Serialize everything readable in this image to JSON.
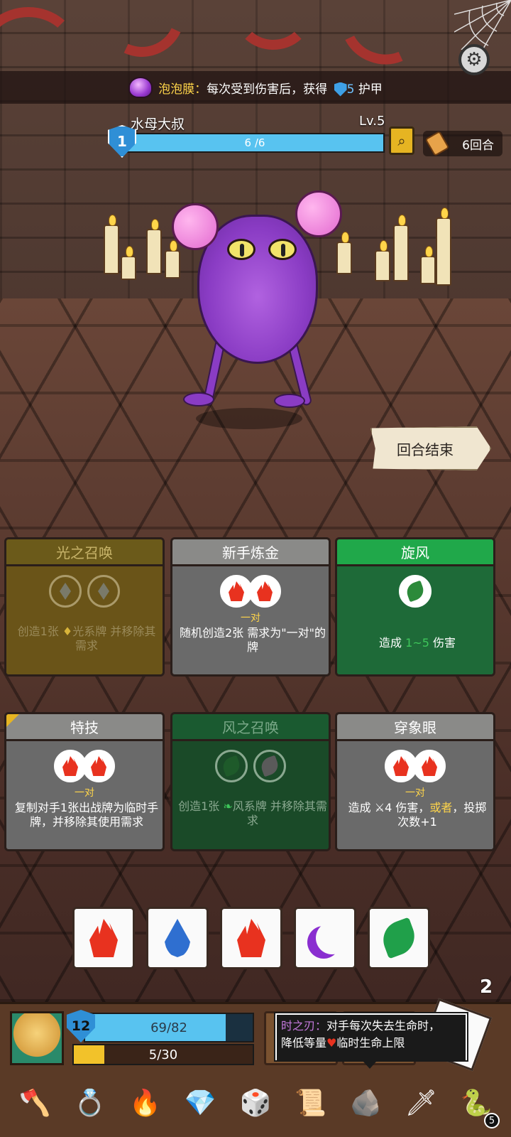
{
  "status_effect": {
    "name": "泡泡膜：",
    "text": "每次受到伤害后，获得",
    "armor_value": "5",
    "armor_label": "护甲",
    "icon": "bubble-icon"
  },
  "enemy": {
    "name": "水母大叔",
    "level": "Lv.5",
    "shield": "1",
    "hp_text": "6 /6",
    "hp_fraction": 1.0,
    "rounds": "6回合"
  },
  "end_turn_label": "回合结束",
  "cards": [
    {
      "title": "光之召唤",
      "pair": "",
      "desc_a": "创造1张 ",
      "desc_gem": "♦",
      "desc_b": "光系牌 并移除其需求"
    },
    {
      "title": "新手炼金",
      "pair": "一对",
      "desc": "随机创造2张 需求为\"一对\"的牌"
    },
    {
      "title": "旋风",
      "pair": "",
      "desc_a": "造成 ",
      "desc_hl": "1~5",
      "desc_b": " 伤害"
    },
    {
      "title": "特技",
      "pair": "一对",
      "desc": "复制对手1张出战牌为临时手牌，并移除其使用需求"
    },
    {
      "title": "风之召唤",
      "pair": "",
      "desc_a": "创造1张 ",
      "desc_b": "风系牌 并移除其需求"
    },
    {
      "title": "穿象眼",
      "pair": "一对",
      "desc_a": "造成 ",
      "desc_b": "4 伤害，",
      "desc_hl": "或者",
      "desc_c": "，投掷次数+1"
    }
  ],
  "dice": [
    "fire",
    "water",
    "fire",
    "moon",
    "wind"
  ],
  "reroll_count": "2",
  "player": {
    "shield": "12",
    "hp_text": "69/82",
    "hp_fraction": 0.84,
    "xp_text": "5/30",
    "xp_fraction": 0.17
  },
  "tooltip": {
    "name": "时之刃：",
    "line1": "对手每次失去生命时，",
    "line2_a": "降低等量",
    "line2_b": "临时生命上限"
  },
  "relics": [
    {
      "name": "axe-relic-icon",
      "glyph": "🪓"
    },
    {
      "name": "ring-relic-icon",
      "glyph": "💍"
    },
    {
      "name": "flame-potion-relic-icon",
      "glyph": "🔥"
    },
    {
      "name": "crystal-relic-icon",
      "glyph": "💎"
    },
    {
      "name": "d20-relic-icon",
      "glyph": "🎲"
    },
    {
      "name": "scroll-relic-icon",
      "glyph": "📜"
    },
    {
      "name": "meteor-relic-icon",
      "glyph": "🪨"
    },
    {
      "name": "time-blade-relic-icon",
      "glyph": "🗡"
    },
    {
      "name": "serpent-relic-icon",
      "glyph": "🐍",
      "count": "5"
    }
  ]
}
